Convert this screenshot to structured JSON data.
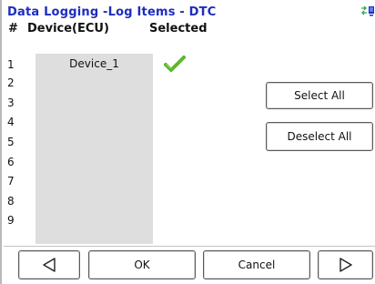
{
  "window": {
    "title": "Data Logging -Log Items - DTC",
    "status_icon": "connection-status-icon"
  },
  "table": {
    "headers": {
      "number": "#",
      "device": "Device(ECU)",
      "selected": "Selected"
    },
    "row_numbers": [
      "1",
      "2",
      "3",
      "4",
      "5",
      "6",
      "7",
      "8",
      "9"
    ],
    "rows": [
      {
        "device": "Device_1",
        "selected": true,
        "selected_icon": "checkmark-icon"
      }
    ]
  },
  "actions": {
    "select_all": "Select All",
    "deselect_all": "Deselect All"
  },
  "footer": {
    "prev_icon": "left-triangle-icon",
    "ok": "OK",
    "cancel": "Cancel",
    "next_icon": "right-triangle-icon"
  },
  "colors": {
    "title": "#1d2dbd",
    "list_background": "#dedede",
    "checkmark": "#5fb52c"
  }
}
